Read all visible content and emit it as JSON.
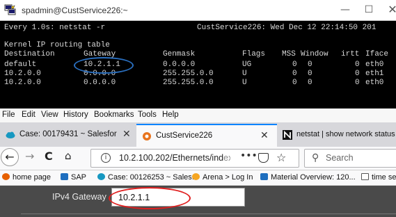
{
  "terminal_window": {
    "title": "spadmin@CustService226:~",
    "controls": {
      "minimize": "—",
      "maximize": "☐",
      "close": "✕"
    },
    "watch_header_left": "Every 1.0s: netstat -r",
    "watch_header_right": "CustService226: Wed Dec 12 22:14:50 201",
    "table_title": "Kernel IP routing table",
    "columns": [
      "Destination",
      "Gateway",
      "Genmask",
      "Flags",
      "MSS",
      "Window",
      "irtt",
      "Iface"
    ],
    "rows": [
      [
        "default",
        "10.2.1.1",
        "0.0.0.0",
        "UG",
        "0",
        "0",
        "0",
        "eth0"
      ],
      [
        "10.2.0.0",
        "0.0.0.0",
        "255.255.0.0",
        "U",
        "0",
        "0",
        "0",
        "eth1"
      ],
      [
        "10.2.0.0",
        "0.0.0.0",
        "255.255.0.0",
        "U",
        "0",
        "0",
        "0",
        "eth0"
      ]
    ],
    "annotation_color": "#2a6fbf"
  },
  "browser": {
    "menu": [
      "File",
      "Edit",
      "View",
      "History",
      "Bookmarks",
      "Tools",
      "Help"
    ],
    "tabs": [
      {
        "label": "Case: 00179431 ~ Salesforce - E",
        "icon": "salesforce-cloud-icon",
        "close": "✕"
      },
      {
        "label": "CustService226",
        "icon": "site-favicon-icon",
        "close": "✕",
        "active": true
      },
      {
        "label": "netstat | show network status",
        "icon": "n-logo-icon"
      }
    ],
    "nav": {
      "back": "←",
      "forward": "→",
      "reload": "C",
      "home": "⌂"
    },
    "url": {
      "main": "10.2.100.202/Ethernets/ind",
      "faded": "ex",
      "info": "i"
    },
    "page_actions": "•••",
    "star": "☆",
    "search": {
      "placeholder": "Search",
      "icon": "⚲"
    },
    "bookmarks": [
      {
        "label": "home page",
        "icon": "firefox-icon"
      },
      {
        "label": "SAP",
        "icon": "plug-icon"
      },
      {
        "label": "Case: 00126253 ~ Sales...",
        "icon": "salesforce-cloud-icon"
      },
      {
        "label": "Arena > Log In",
        "icon": "arena-icon"
      },
      {
        "label": "Material Overview: 120...",
        "icon": "plug-icon"
      },
      {
        "label": "time se",
        "icon": "folder-icon"
      }
    ],
    "content": {
      "label": "IPv4 Gateway",
      "value": "10.2.1.1"
    },
    "annotation_color": "#e02020"
  }
}
